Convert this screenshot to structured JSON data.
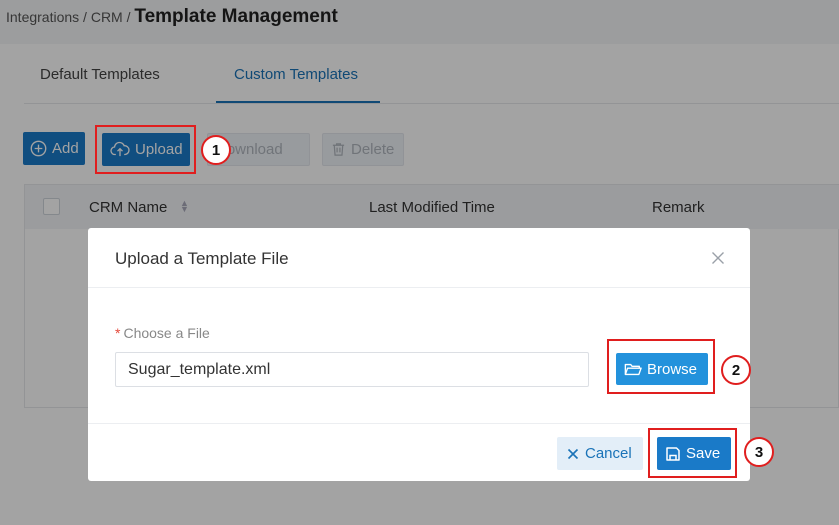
{
  "breadcrumb": {
    "part1": "Integrations /",
    "part2": "CRM /",
    "current": "Template Management"
  },
  "tabs": [
    {
      "label": "Default Templates",
      "active": false
    },
    {
      "label": "Custom Templates",
      "active": true
    }
  ],
  "toolbar": {
    "add_label": "Add",
    "upload_label": "Upload",
    "download_label": "Download",
    "delete_label": "Delete"
  },
  "table": {
    "columns": [
      "CRM Name",
      "Last Modified Time",
      "Remark"
    ]
  },
  "dialog": {
    "title": "Upload a Template File",
    "required_mark": "*",
    "field_label": "Choose a File",
    "file_value": "Sugar_template.xml",
    "browse_label": "Browse",
    "cancel_label": "Cancel",
    "save_label": "Save"
  },
  "steps": [
    "1",
    "2",
    "3"
  ],
  "colors": {
    "primary": "#1a7ac8",
    "browse": "#2392dc",
    "callout": "#e01e1e",
    "required": "#e4483a"
  },
  "icons": {
    "add": "plus-circle-icon",
    "upload": "cloud-upload-icon",
    "delete": "trash-icon",
    "close": "close-icon",
    "browse": "folder-open-icon",
    "cancel": "x-icon",
    "save": "save-icon",
    "sort": "sort-icon"
  }
}
